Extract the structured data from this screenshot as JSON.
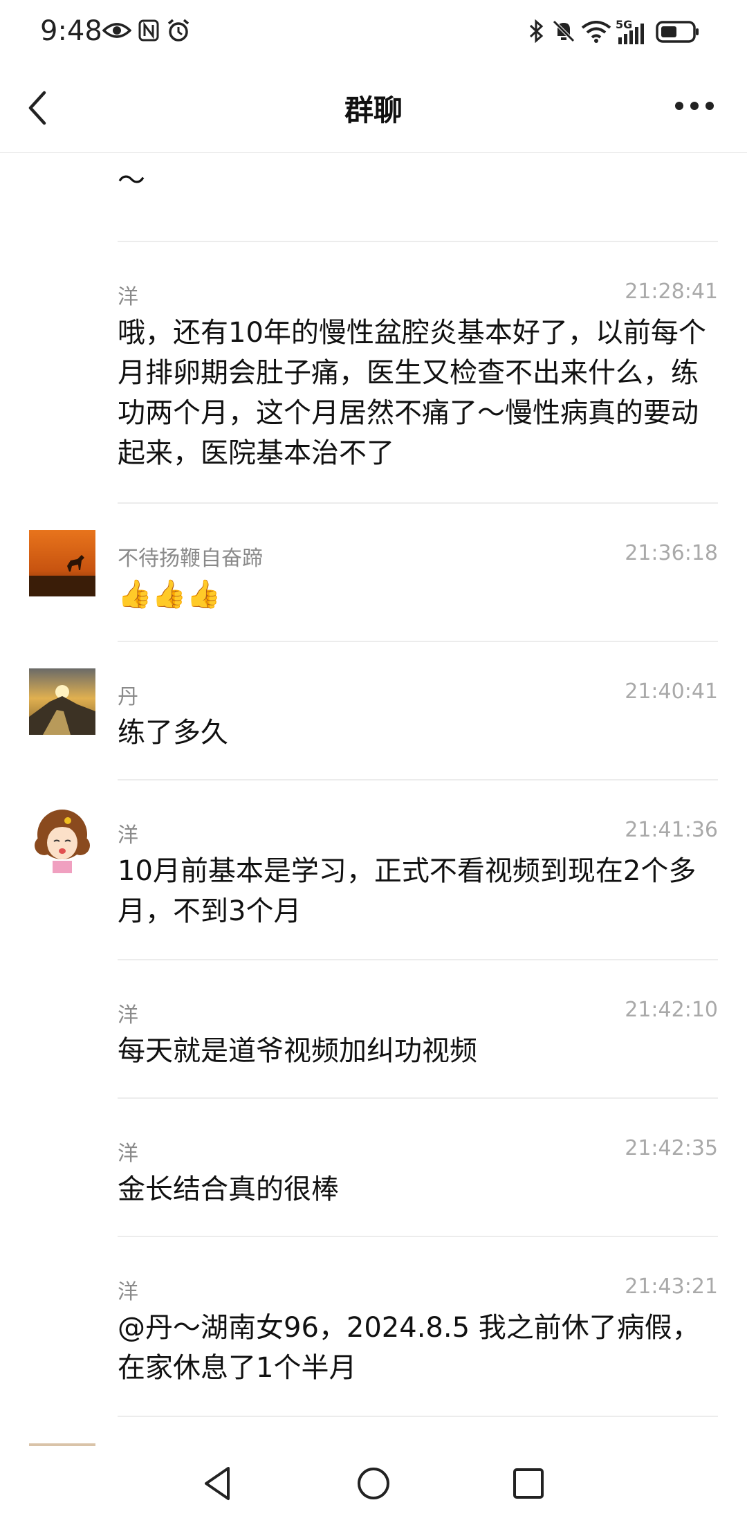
{
  "status_bar": {
    "time": "9:48",
    "left_icons": [
      "eye-icon",
      "nfc-icon",
      "alarm-icon"
    ],
    "right_icons": [
      "bluetooth-icon",
      "mute-icon",
      "wifi-icon",
      "signal-5g-icon",
      "battery-icon"
    ],
    "network_label": "5G"
  },
  "header": {
    "title": "群聊",
    "back_icon": "chevron-left-icon",
    "more_icon": "more-horizontal-icon"
  },
  "partial_message": {
    "text": "量的群，每天一起打卡，感恩😊忍不住想分享的～"
  },
  "messages": [
    {
      "sender": "洋",
      "time": "21:28:41",
      "text": "哦，还有10年的慢性盆腔炎基本好了，以前每个月排卵期会肚子痛，医生又检查不出来什么，练功两个月，这个月居然不痛了～慢性病真的要动起来，医院基本治不了",
      "avatar": "none"
    },
    {
      "sender": "不待扬鞭自奋蹄",
      "time": "21:36:18",
      "text": "👍👍👍",
      "avatar": "sunset-horse-avatar"
    },
    {
      "sender": "丹",
      "time": "21:40:41",
      "text": "练了多久",
      "avatar": "mountain-sunrise-avatar"
    },
    {
      "sender": "洋",
      "time": "21:41:36",
      "text": "10月前基本是学习，正式不看视频到现在2个多月，不到3个月",
      "avatar": "cartoon-girl-avatar"
    },
    {
      "sender": "洋",
      "time": "21:42:10",
      "text": "每天就是道爷视频加纠功视频",
      "avatar": "none"
    },
    {
      "sender": "洋",
      "time": "21:42:35",
      "text": "金长结合真的很棒",
      "avatar": "none"
    },
    {
      "sender": "洋",
      "time": "21:43:21",
      "text": "@丹～湖南女96，2024.8.5 我之前休了病假，在家休息了1个半月",
      "avatar": "none"
    }
  ],
  "system_nav": {
    "back": "triangle-back-icon",
    "home": "circle-home-icon",
    "recents": "square-recents-icon"
  }
}
